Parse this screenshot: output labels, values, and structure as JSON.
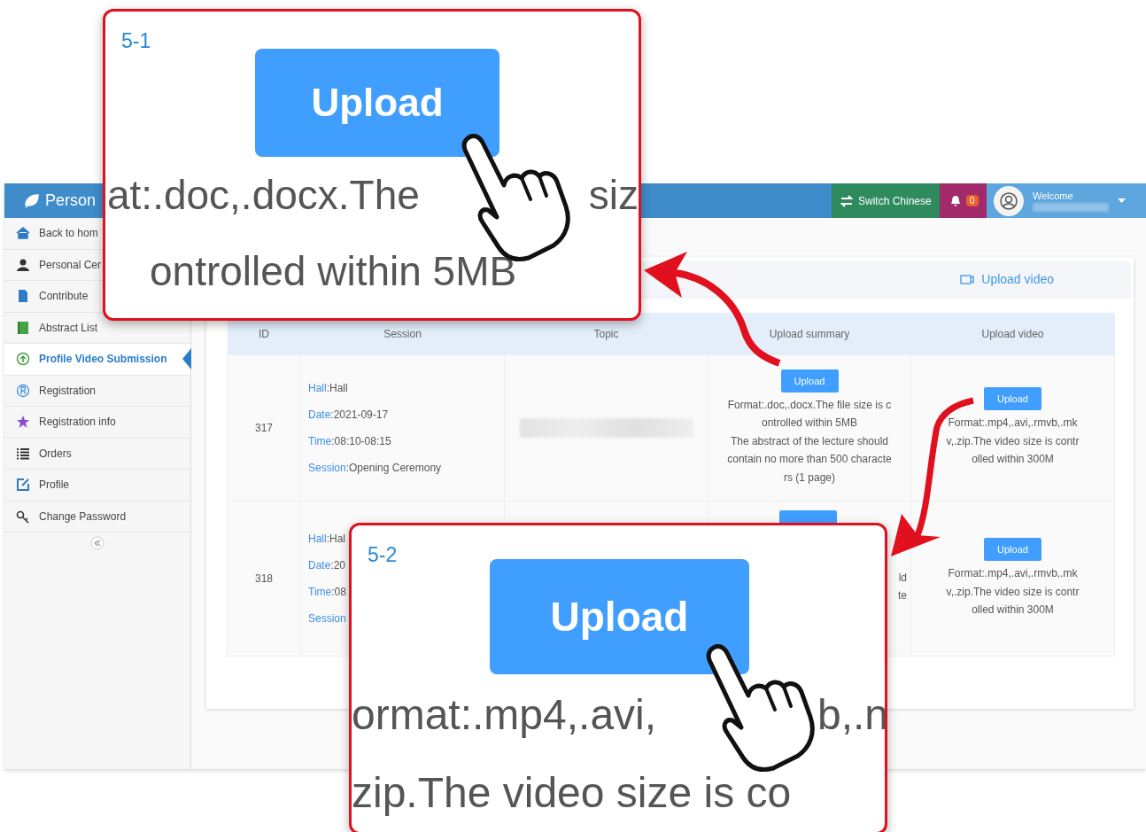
{
  "header": {
    "title": "Person",
    "switch_language": "Switch Chinese",
    "notification_count": "0",
    "greeting": "Welcome"
  },
  "sidebar": {
    "items": [
      {
        "label": "Back to hom",
        "kind": "home",
        "selected": false
      },
      {
        "label": "Personal Cer",
        "kind": "user",
        "selected": false
      },
      {
        "label": "Contribute",
        "kind": "file",
        "selected": false
      },
      {
        "label": "Abstract List",
        "kind": "book",
        "selected": false
      },
      {
        "label": "Profile Video Submission",
        "kind": "upload",
        "selected": true
      },
      {
        "label": "Registration",
        "kind": "registered",
        "selected": false
      },
      {
        "label": "Registration info",
        "kind": "star",
        "selected": false
      },
      {
        "label": "Orders",
        "kind": "list",
        "selected": false
      },
      {
        "label": "Profile",
        "kind": "edit",
        "selected": false
      },
      {
        "label": "Change Password",
        "kind": "key",
        "selected": false
      }
    ]
  },
  "toolbar": {
    "upload_video_link": "Upload video"
  },
  "table": {
    "columns": [
      "ID",
      "Session",
      "Topic",
      "Upload summary",
      "Upload video"
    ],
    "rows": [
      {
        "id": "317",
        "session": [
          {
            "label": "Hall",
            "value": ":Hall"
          },
          {
            "label": "Date",
            "value": ":2021-09-17"
          },
          {
            "label": "Time",
            "value": ":08:10-08:15"
          },
          {
            "label": "Session",
            "value": ":Opening Ceremony"
          }
        ],
        "topic_redacted": true,
        "summary": {
          "button": "Upload",
          "lines": [
            "Format:.doc,.docx.The file size is c",
            "ontrolled within 5MB",
            "The abstract of the lecture should",
            "contain no more than 500 characte",
            "rs (1 page)"
          ]
        },
        "video": {
          "button": "Upload",
          "lines": [
            "Format:.mp4,.avi,.rmvb,.mk",
            "v,.zip.The video size is contr",
            "olled within 300M"
          ]
        }
      },
      {
        "id": "318",
        "session": [
          {
            "label": "Hall",
            "value": ":Hal"
          },
          {
            "label": "Date",
            "value": ":20"
          },
          {
            "label": "Time",
            "value": ":08"
          },
          {
            "label": "Session"
          }
        ],
        "topic_redacted": false,
        "summary": {
          "lines": [
            "ld",
            "te"
          ]
        },
        "video": {
          "button": "Upload",
          "lines": [
            "Format:.mp4,.avi,.rmvb,.mk",
            "v,.zip.The video size is contr",
            "olled within 300M"
          ]
        }
      }
    ]
  },
  "callouts": [
    {
      "number": "5-1",
      "button": "Upload",
      "lines": [
        [
          "at:.doc,.docx.The",
          "siz"
        ],
        [
          "ontrolled within 5MB"
        ]
      ]
    },
    {
      "number": "5-2",
      "button": "Upload",
      "lines": [
        [
          "ormat:.mp4,.avi,",
          "b,.n"
        ],
        [
          "zip.The video size is co"
        ]
      ]
    }
  ]
}
